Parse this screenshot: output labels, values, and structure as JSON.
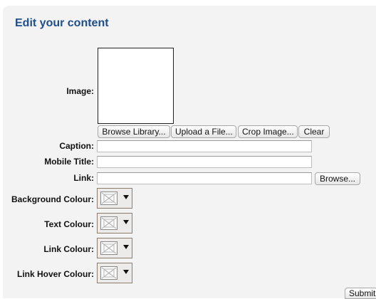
{
  "header": {
    "title": "Edit your content"
  },
  "image": {
    "label": "Image:",
    "buttons": [
      "Browse Library...",
      "Upload a File...",
      "Crop Image...",
      "Clear"
    ]
  },
  "fields": {
    "caption": {
      "label": "Caption:",
      "value": ""
    },
    "mobile_title": {
      "label": "Mobile Title:",
      "value": ""
    },
    "link": {
      "label": "Link:",
      "value": "",
      "browse_label": "Browse..."
    }
  },
  "colours": {
    "background": {
      "label": "Background Colour:"
    },
    "text": {
      "label": "Text Colour:"
    },
    "link": {
      "label": "Link Colour:"
    },
    "link_hover": {
      "label": "Link Hover Colour:"
    },
    "dropdown_icon": "triangle-down",
    "swatch_icon": "empty-colour-swatch"
  },
  "footer": {
    "submit_label": "Submit"
  }
}
